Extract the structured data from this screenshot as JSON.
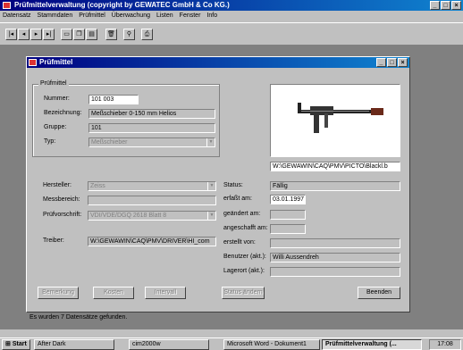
{
  "app": {
    "title": "Prüfmittelverwaltung (copyright by GEWATEC GmbH & Co KG.)",
    "controls": [
      "_",
      "□",
      "×"
    ]
  },
  "menu": [
    "Datensatz",
    "Stammdaten",
    "Prüfmittel",
    "Überwachung",
    "Listen",
    "Fenster",
    "Info"
  ],
  "toolbar": {
    "buttons": [
      "first-icon",
      "prev-icon",
      "next-icon",
      "last-icon",
      "new-icon",
      "copy-icon",
      "save-icon",
      "delete-icon",
      "search-icon",
      "print-icon"
    ]
  },
  "window": {
    "title": "Prüfmittel",
    "group_label": "Prüfmittel",
    "fields": {
      "nummer": {
        "label": "Nummer:",
        "value": "101 003"
      },
      "bezeichnung": {
        "label": "Bezeichnung:",
        "value": "Meßschieber 0-150 mm Helios"
      },
      "gruppe": {
        "label": "Gruppe:",
        "value": "101"
      },
      "typ": {
        "label": "Typ:",
        "value": "Meßschieber"
      },
      "hersteller": {
        "label": "Hersteller:",
        "value": "Zeiss"
      },
      "messbereich": {
        "label": "Messbereich:",
        "value": ""
      },
      "pruefvorschrift": {
        "label": "Prüfvorschrift:",
        "value": "VDI/VDE/DGQ 2618 Blatt 8"
      },
      "treiber": {
        "label": "Treiber:",
        "value": "W:\\GEWAWIN\\CAQ\\PMV\\DRIVER\\HI_com"
      },
      "picture_path": {
        "value": "W:\\GEWAWIN\\CAQ\\PMV\\PICTO\\Blackl.b"
      },
      "status": {
        "label": "Status:",
        "value": "Fällig"
      },
      "erfasst_am": {
        "label": "erfaßt am:",
        "value": "03.01.1997"
      },
      "geaendert_am": {
        "label": "geändert am:",
        "value": ""
      },
      "angeschafft_am": {
        "label": "angeschafft am:",
        "value": ""
      },
      "erstellt_von": {
        "label": "erstellt von:",
        "value": ""
      },
      "benutzer": {
        "label": "Benutzer (akt.):",
        "value": "Willi Aussendreh"
      },
      "lagerort": {
        "label": "Lagerort (akt.):",
        "value": ""
      }
    },
    "buttons": {
      "bemerkung": "Bemerkung",
      "kosten": "Kosten",
      "intervall": "Intervall",
      "status_aendern": "Status ändern",
      "beenden": "Beenden"
    }
  },
  "statusbar": {
    "text": "Es wurden 7 Datensätze gefunden."
  },
  "taskbar": {
    "start": "Start",
    "tasks": [
      "After Dark",
      "cim2000w",
      "Microsoft Word - Dokument1",
      "Prüfmittelverwaltung (..."
    ],
    "clock": "17:08"
  },
  "colors": {
    "titlebar": "#000080",
    "face": "#c0c0c0",
    "workspace": "#808080"
  }
}
